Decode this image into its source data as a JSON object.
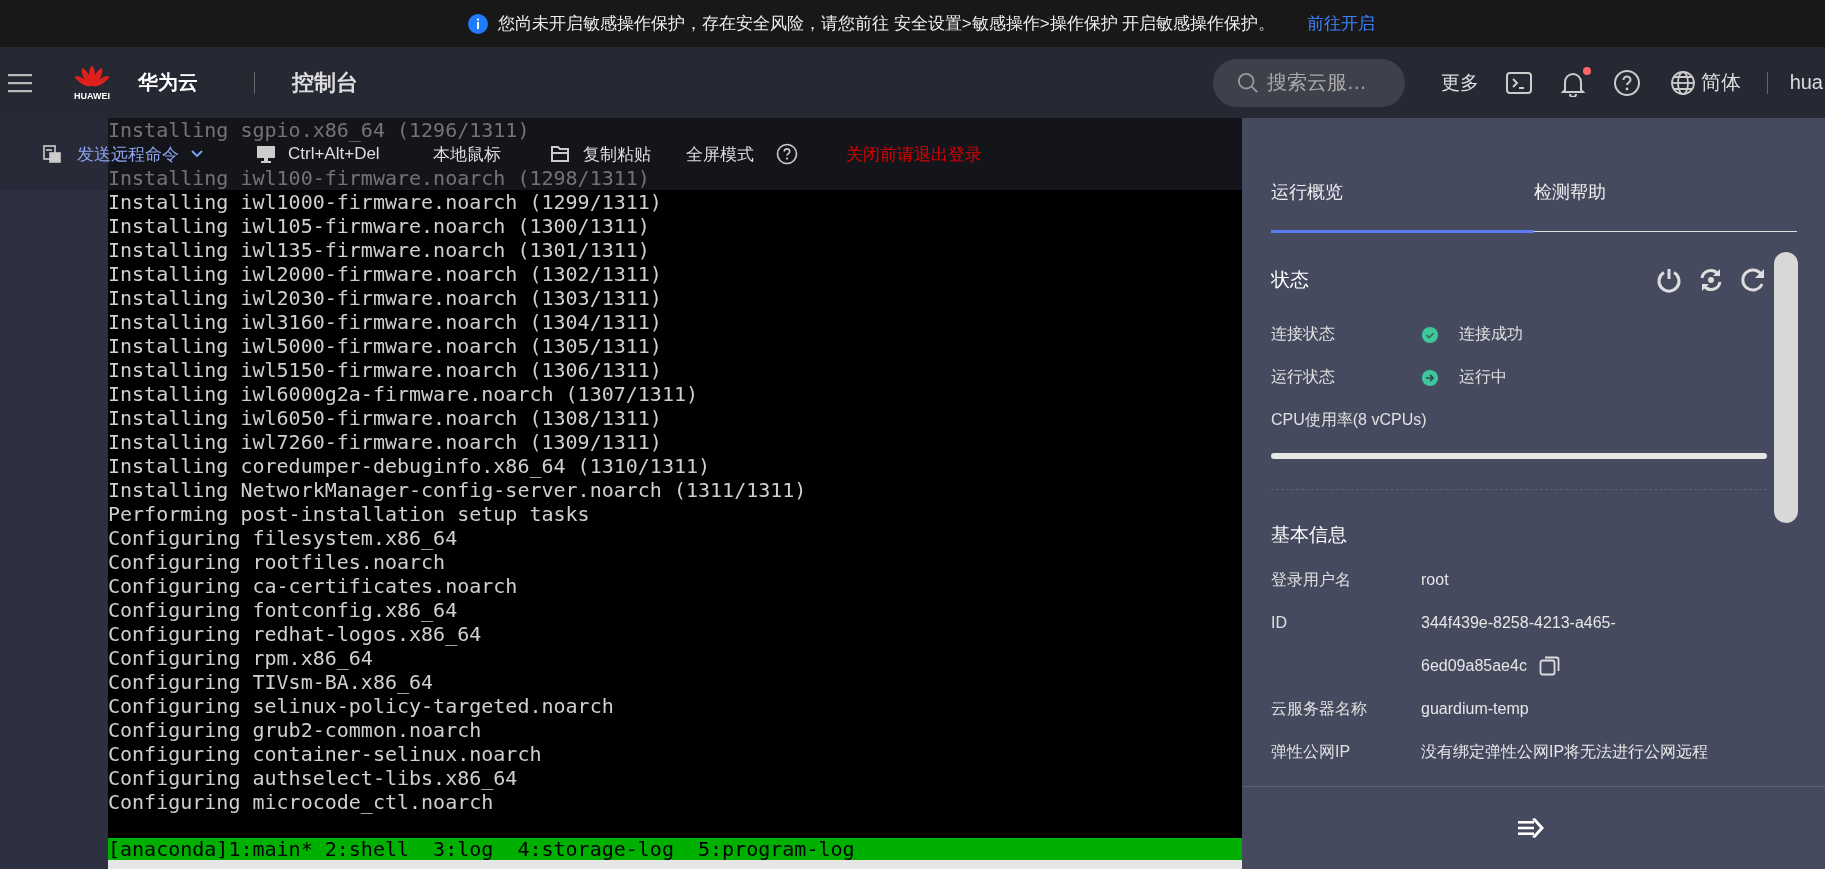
{
  "banner": {
    "message": "您尚未开启敏感操作保护，存在安全风险，请您前往 安全设置>敏感操作>操作保护 开启敏感操作保护。",
    "link": "前往开启"
  },
  "header": {
    "logo_text": "HUAWEI",
    "brand": "华为云",
    "title": "控制台",
    "search": {
      "placeholder": "搜索云服…"
    },
    "more": "更多",
    "notification_dot": true,
    "language": "简体",
    "user": "hua"
  },
  "toolbar": {
    "items": [
      {
        "kind": "command",
        "label": "发送远程命令"
      },
      {
        "kind": "keys",
        "label": "Ctrl+Alt+Del"
      },
      {
        "kind": "plain",
        "label": "本地鼠标"
      },
      {
        "kind": "clipboard",
        "label": "复制粘贴"
      },
      {
        "kind": "fullscreen",
        "label": "全屏模式"
      }
    ],
    "warning": "关闭前请退出登录"
  },
  "terminal": {
    "lines": [
      "Installing sgpio.x86_64 (1296/1311)",
      "Installing iwl100-firmware.noarch (1298/1311)",
      "Installing iwl1000-firmware.noarch (1299/1311)",
      "Installing iwl105-firmware.noarch (1300/1311)",
      "Installing iwl135-firmware.noarch (1301/1311)",
      "Installing iwl2000-firmware.noarch (1302/1311)",
      "Installing iwl2030-firmware.noarch (1303/1311)",
      "Installing iwl3160-firmware.noarch (1304/1311)",
      "Installing iwl5000-firmware.noarch (1305/1311)",
      "Installing iwl5150-firmware.noarch (1306/1311)",
      "Installing iwl6000g2a-firmware.noarch (1307/1311)",
      "Installing iwl6050-firmware.noarch (1308/1311)",
      "Installing iwl7260-firmware.noarch (1309/1311)",
      "Installing coredumper-debuginfo.x86_64 (1310/1311)",
      "Installing NetworkManager-config-server.noarch (1311/1311)",
      "Performing post-installation setup tasks",
      "Configuring filesystem.x86_64",
      "Configuring rootfiles.noarch",
      "Configuring ca-certificates.noarch",
      "Configuring fontconfig.x86_64",
      "Configuring redhat-logos.x86_64",
      "Configuring rpm.x86_64",
      "Configuring TIVsm-BA.x86_64",
      "Configuring selinux-policy-targeted.noarch",
      "Configuring grub2-common.noarch",
      "Configuring container-selinux.noarch",
      "Configuring authselect-libs.x86_64",
      "Configuring microcode_ctl.noarch"
    ],
    "status_bar": "[anaconda]1:main* 2:shell  3:log  4:storage-log  5:program-log"
  },
  "panel": {
    "tabs": [
      {
        "label": "运行概览",
        "selected": true
      },
      {
        "label": "检测帮助",
        "selected": false
      }
    ],
    "status": {
      "title": "状态",
      "rows": [
        {
          "label": "连接状态",
          "kind": "success",
          "value": "连接成功"
        },
        {
          "label": "运行状态",
          "kind": "running",
          "value": "运行中"
        }
      ],
      "cpu": {
        "label": "CPU使用率(8 vCPUs)",
        "level": 0
      }
    },
    "basic_info": {
      "title": "基本信息",
      "rows": [
        {
          "label": "登录用户名",
          "value": "root"
        },
        {
          "label": "ID",
          "value": "344f439e-8258-4213-a465-",
          "continuation": "6ed09a85ae4c"
        },
        {
          "label": "云服务器名称",
          "value": "guardium-temp"
        },
        {
          "label": "弹性公网IP",
          "value": "没有绑定弹性公网IP将无法进行公网远程"
        }
      ]
    }
  }
}
